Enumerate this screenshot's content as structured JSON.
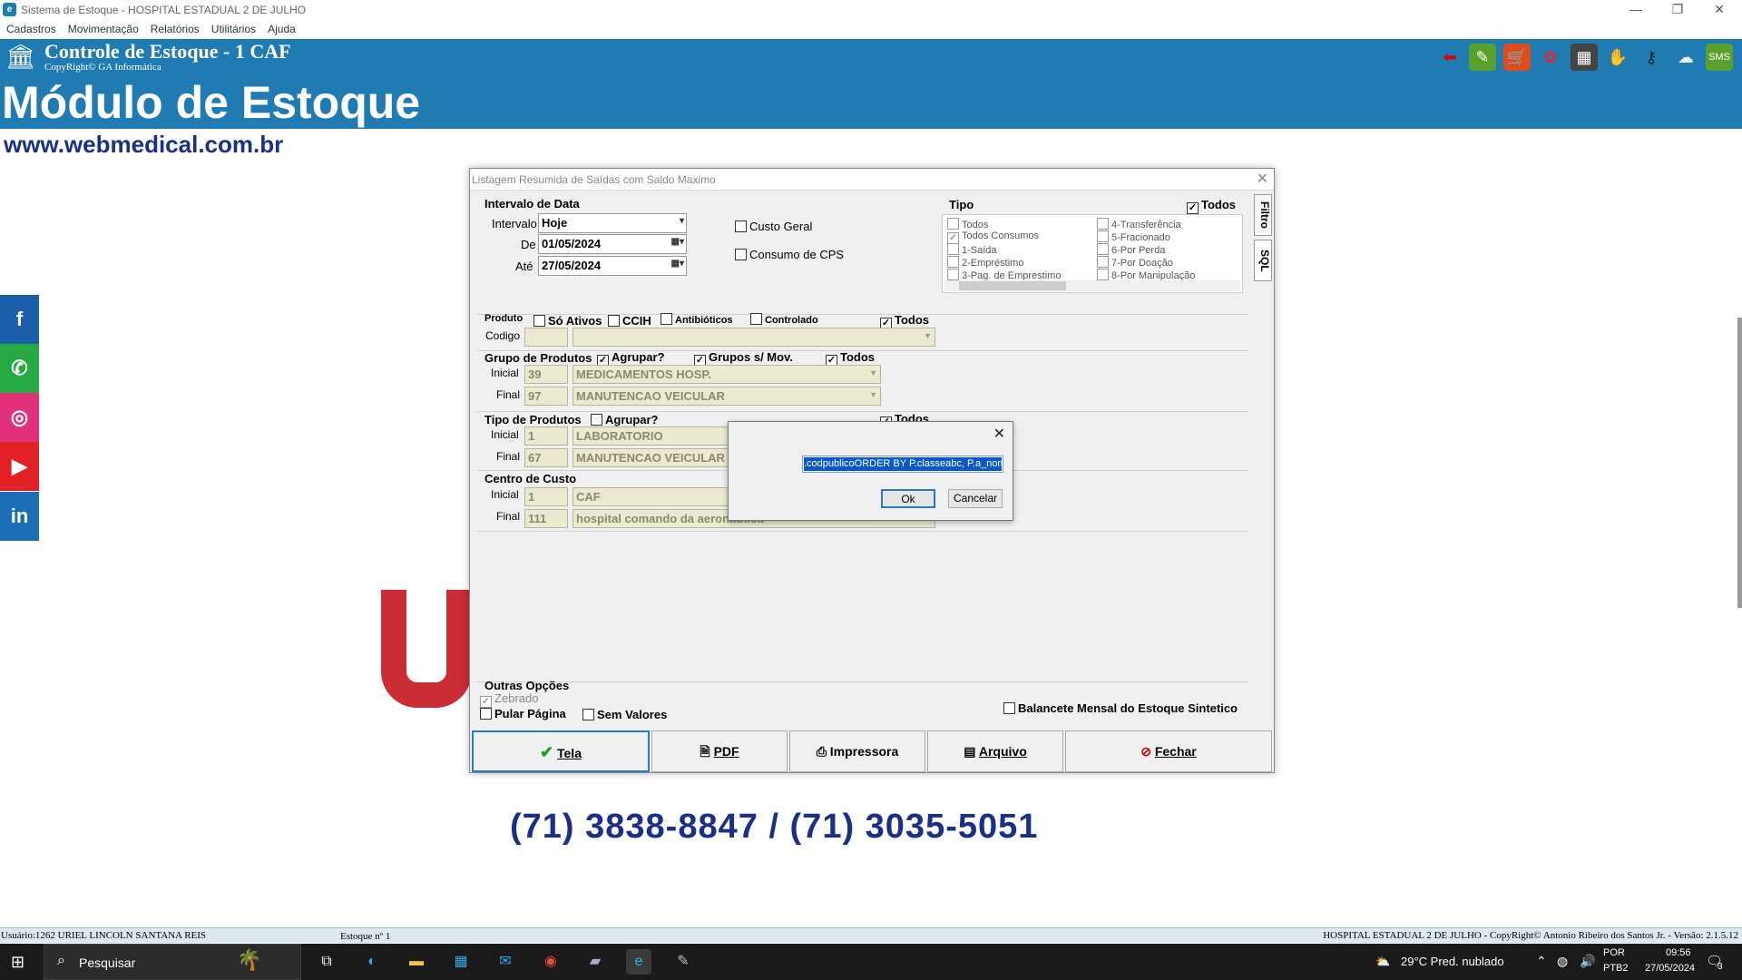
{
  "window": {
    "title": "Sistema de Estoque - HOSPITAL ESTADUAL 2 DE JULHO"
  },
  "menu": [
    "Cadastros",
    "Movimentação",
    "Relatórios",
    "Utilitários",
    "Ajuda"
  ],
  "header": {
    "title": "Controle de Estoque - 1 CAF",
    "copyright": "CopyRight© GA Informática"
  },
  "banner": {
    "module": "Módulo de Estoque",
    "url": "www.webmedical.com.br",
    "phone": "(71) 3838-8847 / (71) 3035-5051"
  },
  "social": [
    "facebook-icon",
    "whatsapp-icon",
    "instagram-icon",
    "youtube-icon",
    "linkedin-icon"
  ],
  "dialog": {
    "title": "Listagem Resumida de Saídas com Saldo Maximo",
    "date": {
      "section": "Intervalo de Data",
      "interval_label": "Intervalo",
      "interval_value": "Hoje",
      "from_label": "De",
      "from_value": "01/05/2024",
      "to_label": "Até",
      "to_value": "27/05/2024"
    },
    "custo_geral": "Custo Geral",
    "consumo_cps": "Consumo de CPS",
    "tipo": {
      "section": "Tipo",
      "todos": "Todos",
      "left": [
        "Todos",
        "Todos Consumos",
        "1-Saída",
        "2-Empréstimo",
        "3-Pag. de Emprestimo"
      ],
      "right": [
        "4-Transferência",
        "5-Fracionado",
        "6-Por Perda",
        "7-Por Doação",
        "8-Por Manipulação"
      ]
    },
    "tabs": [
      "Filtro",
      "SQL"
    ],
    "produto": {
      "section": "Produto",
      "so_ativos": "Só Ativos",
      "ccih": "CCIH",
      "antibioticos": "Antibióticos",
      "controlado": "Controlado",
      "todos": "Todos",
      "codigo_label": "Codigo"
    },
    "grupo": {
      "section": "Grupo de Produtos",
      "agrupar": "Agrupar?",
      "grupos_sem_mov": "Grupos s/ Mov.",
      "todos": "Todos",
      "inicial_label": "Inicial",
      "inicial_code": "39",
      "inicial_name": "MEDICAMENTOS HOSP.",
      "final_label": "Final",
      "final_code": "97",
      "final_name": "MANUTENCAO VEICULAR"
    },
    "tipo_prod": {
      "section": "Tipo de Produtos",
      "agrupar": "Agrupar?",
      "todos": "Todos",
      "inicial_label": "Inicial",
      "inicial_code": "1",
      "inicial_name": "LABORATORIO",
      "final_label": "Final",
      "final_code": "67",
      "final_name": "MANUTENCAO VEICULAR"
    },
    "centro": {
      "section": "Centro de Custo",
      "inicial_label": "Inicial",
      "inicial_code": "1",
      "inicial_name": "CAF",
      "final_label": "Final",
      "final_code": "111",
      "final_name": "hospital comando da aeronáutica"
    },
    "outras": {
      "section": "Outras Opções",
      "zebrado": "Zebrado",
      "pular": "Pular Página",
      "sem_valores": "Sem Valores",
      "balancete": "Balancete Mensal do Estoque Sintetico"
    },
    "buttons": {
      "tela": "Tela",
      "pdf": "PDF",
      "impressora": "Impressora",
      "arquivo": "Arquivo",
      "fechar": "Fechar"
    }
  },
  "prompt": {
    "value": ".codpublicoORDER BY P.classeabc, P.a_nome",
    "ok": "Ok",
    "cancel": "Cancelar"
  },
  "status": {
    "user": "Usuário:1262 URIEL LINCOLN SANTANA REIS",
    "estoque": "Estoque nº 1",
    "right": "HOSPITAL ESTADUAL 2 DE JULHO - CopyRight© Antonio Ribeiro dos Santos Jr. - Versão: 2.1.5.12"
  },
  "taskbar": {
    "search": "Pesquisar",
    "weather": "29°C  Pred. nublado",
    "lang1": "POR",
    "lang2": "PTB2",
    "time": "09:56",
    "date": "27/05/2024",
    "notif": "3"
  }
}
